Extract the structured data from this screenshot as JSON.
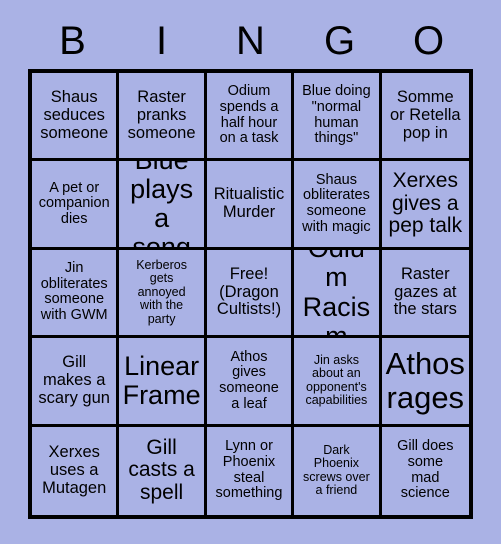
{
  "card": {
    "title": "BINGO",
    "background_color": "#aab2e5",
    "line_color": "#000000",
    "text_color": "#000000",
    "header_letters": [
      "B",
      "I",
      "N",
      "G",
      "O"
    ],
    "rows": 5,
    "columns": 5,
    "cells": [
      {
        "text": "Shaus\nseduces\nsomeone",
        "size": "fs-m"
      },
      {
        "text": "Raster\npranks\nsomeone",
        "size": "fs-m"
      },
      {
        "text": "Odium\nspends a\nhalf hour\non a task",
        "size": "fs-s"
      },
      {
        "text": "Blue doing\n\"normal\nhuman\nthings\"",
        "size": "fs-s"
      },
      {
        "text": "Somme\nor Retella\npop in",
        "size": "fs-m"
      },
      {
        "text": "A pet or\ncompanion\ndies",
        "size": "fs-s"
      },
      {
        "text": "Blue\nplays a\nsong",
        "size": "fs-xl"
      },
      {
        "text": "Ritualistic\nMurder",
        "size": "fs-m"
      },
      {
        "text": "Shaus\nobliterates\nsomeone\nwith magic",
        "size": "fs-s"
      },
      {
        "text": "Xerxes\ngives a\npep talk",
        "size": "fs-l"
      },
      {
        "text": "Jin\nobliterates\nsomeone\nwith GWM",
        "size": "fs-s"
      },
      {
        "text": "Kerberos\ngets\nannoyed\nwith the\nparty",
        "size": "fs-xs"
      },
      {
        "text": "Free!\n(Dragon\nCultists!)",
        "size": "fs-m"
      },
      {
        "text": "Odium\nRacism",
        "size": "fs-xl"
      },
      {
        "text": "Raster\ngazes at\nthe stars",
        "size": "fs-m"
      },
      {
        "text": "Gill\nmakes a\nscary gun",
        "size": "fs-m"
      },
      {
        "text": "Linear\nFrame",
        "size": "fs-xl"
      },
      {
        "text": "Athos\ngives\nsomeone\na leaf",
        "size": "fs-s"
      },
      {
        "text": "Jin asks\nabout an\nopponent's\ncapabilities",
        "size": "fs-xs"
      },
      {
        "text": "Athos\nrages",
        "size": "fs-xxl"
      },
      {
        "text": "Xerxes\nuses a\nMutagen",
        "size": "fs-m"
      },
      {
        "text": "Gill\ncasts a\nspell",
        "size": "fs-l"
      },
      {
        "text": "Lynn or\nPhoenix\nsteal\nsomething",
        "size": "fs-s"
      },
      {
        "text": "Dark\nPhoenix\nscrews over\na friend",
        "size": "fs-xs"
      },
      {
        "text": "Gill does\nsome\nmad\nscience",
        "size": "fs-s"
      }
    ]
  }
}
